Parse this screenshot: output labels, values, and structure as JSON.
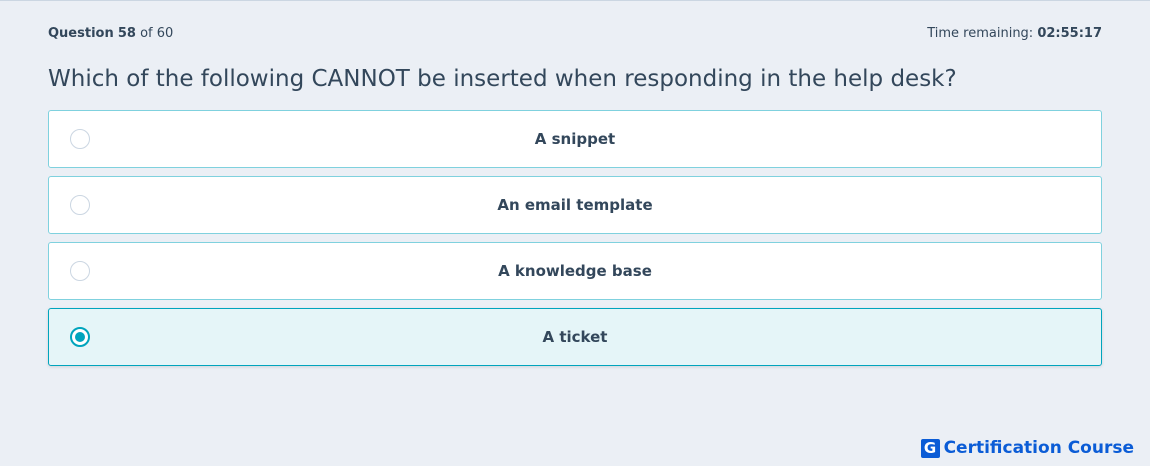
{
  "header": {
    "question_label": "Question",
    "question_number": "58",
    "of_text": "of 60",
    "time_label": "Time remaining:",
    "time_value": "02:55:17"
  },
  "question": {
    "text": "Which of the following CANNOT be inserted when responding in the help desk?"
  },
  "options": [
    {
      "label": "A snippet",
      "selected": false
    },
    {
      "label": "An email template",
      "selected": false
    },
    {
      "label": "A knowledge base",
      "selected": false
    },
    {
      "label": "A ticket",
      "selected": true
    }
  ],
  "brand": {
    "icon_letter": "G",
    "name": "Certification Course",
    "color": "#0b5cd6"
  },
  "colors": {
    "accent": "#00a4bd",
    "text": "#33475b",
    "background": "#ebeff5"
  }
}
